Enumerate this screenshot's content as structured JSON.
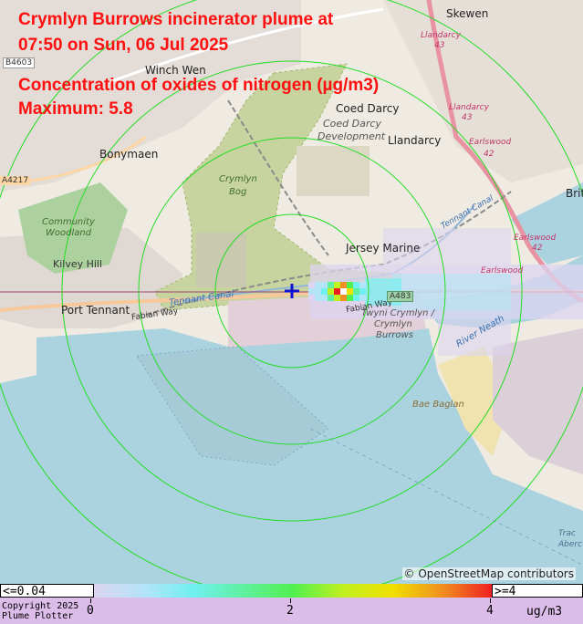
{
  "title": {
    "line1": "Crymlyn Burrows incinerator plume at",
    "line2": "07:50 on Sun, 06 Jul 2025",
    "pollutant": "Concentration of oxides of nitrogen (µg/m3)",
    "maximum": "Maximum: 5.8"
  },
  "map_labels": {
    "skewen": "Skewen",
    "winch_wen": "Winch Wen",
    "coed_darcy": "Coed Darcy",
    "coed_darcy_dev_1": "Coed Darcy",
    "coed_darcy_dev_2": "Development",
    "llandarcy": "Llandarcy",
    "bonymaen": "Bonymaen",
    "crymlyn_bog_1": "Crymlyn",
    "crymlyn_bog_2": "Bog",
    "community_1": "Community",
    "community_2": "Woodland",
    "kilvey_hill": "Kilvey Hill",
    "jersey_marine": "Jersey Marine",
    "port_tennant": "Port Tennant",
    "fabian_way_1": "Fabian Way",
    "fabian_way_2": "Fabian Way",
    "tennant_canal_1": "Tennant Canal",
    "tennant_canal_2": "Tennant Canal",
    "towyn_1": "Twyni Crymlyn /",
    "towyn_2": "Crymlyn",
    "towyn_3": "Burrows",
    "river_neath": "River Neath",
    "baglan_bay": "Bae Baglan",
    "earlswood_1": "Earlswood",
    "earlswood_2": "Earlswood",
    "earlswood_3": "Earlswood",
    "llandarcy_43a": "Llandarcy",
    "llandarcy_43b": "Llandarcy",
    "num_43a": "43",
    "num_43b": "43",
    "num_42a": "42",
    "num_42b": "42",
    "b4603": "B4603",
    "a4217": "A4217",
    "a483": "A483",
    "bri": "Brit",
    "tra": "Trac",
    "aber": "Aberc"
  },
  "attribution": "© OpenStreetMap contributors",
  "legend": {
    "low_label": "<=0.04",
    "high_label": ">=4",
    "ticks": [
      "0",
      "2",
      "4"
    ],
    "units": "ug/m3",
    "copyright_line1": "Copyright 2025",
    "copyright_line2": "Plume Plotter",
    "colors": [
      "#dcd4f0",
      "#b4e4f8",
      "#70f0f0",
      "#60f0a0",
      "#50f050",
      "#c0f020",
      "#f0e000",
      "#f09020",
      "#f02020"
    ]
  },
  "plume": {
    "max_value": 5.8,
    "cells": [
      {
        "v": 0.3
      },
      {
        "v": 0.6
      },
      {
        "v": 1.2
      },
      {
        "v": 2.4
      },
      {
        "v": 4.2
      },
      {
        "v": 5.8
      },
      {
        "v": 3.0
      },
      {
        "v": 1.6
      },
      {
        "v": 0.8
      }
    ]
  }
}
